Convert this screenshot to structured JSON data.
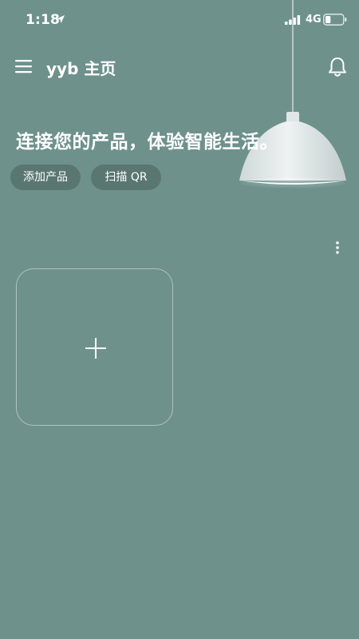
{
  "status_bar": {
    "time": "1:18",
    "network": "4G",
    "battery_level": 0.3,
    "icons": [
      "location-arrow-icon",
      "signal-bars-icon",
      "battery-icon"
    ]
  },
  "header": {
    "title": "yyb 主页",
    "icons": [
      "menu-icon",
      "bell-icon"
    ]
  },
  "main": {
    "headline": "连接您的产品，体验智能生活。",
    "chips": [
      {
        "label": "添加产品"
      },
      {
        "label": "扫描 QR"
      }
    ],
    "icons": [
      "more-vertical-icon",
      "plus-icon",
      "pendant-lamp-illustration"
    ]
  },
  "colors": {
    "background": "#6e918c",
    "chip_background": "#5a7671",
    "text": "#ffffff",
    "lamp_shade": "#e9eeee"
  }
}
